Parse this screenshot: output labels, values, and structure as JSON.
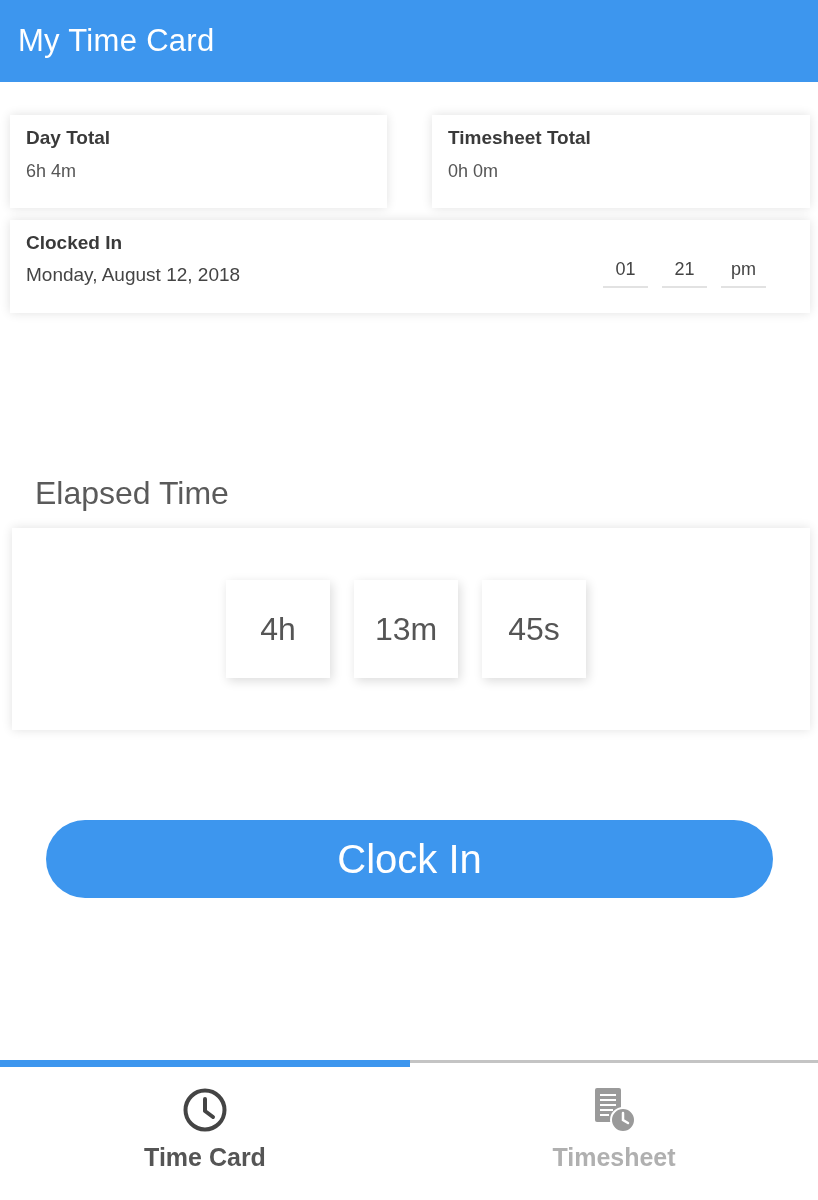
{
  "header": {
    "title": "My Time Card"
  },
  "totals": [
    {
      "label": "Day Total",
      "value": "6h 4m"
    },
    {
      "label": "Timesheet Total",
      "value": "0h 0m"
    }
  ],
  "clocked_in": {
    "label": "Clocked In",
    "date": "Monday, August 12, 2018",
    "time_fields": [
      "01",
      "21",
      "pm"
    ]
  },
  "elapsed": {
    "title": "Elapsed Time",
    "units": [
      "4h",
      "13m",
      "45s"
    ]
  },
  "clock_button": {
    "label": "Clock In"
  },
  "tabs": [
    {
      "kind": "clock",
      "label": "Time Card",
      "selected": true
    },
    {
      "kind": "timesheet",
      "label": "Timesheet",
      "selected": false
    }
  ]
}
